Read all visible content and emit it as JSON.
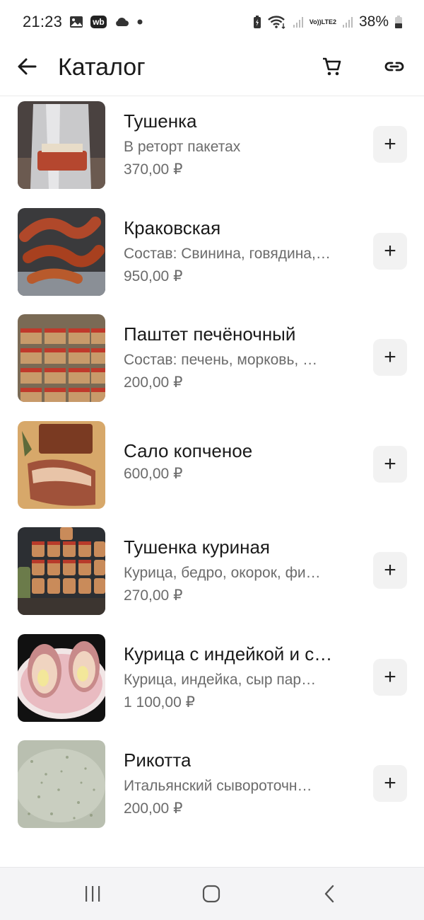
{
  "status_bar": {
    "time": "21:23",
    "wb_badge": "wb",
    "volte_line1": "Vo))",
    "volte_line2": "LTE2",
    "battery": "38%"
  },
  "app_bar": {
    "title": "Каталог",
    "back_icon": "arrow-left-icon",
    "cart_icon": "cart-icon",
    "link_icon": "link-icon"
  },
  "products": [
    {
      "title": "Тушенка",
      "desc": "В реторт пакетах",
      "price": "370,00 ₽",
      "add": "+"
    },
    {
      "title": "Краковская",
      "desc": "Состав: Свинина, говядина,…",
      "price": "950,00 ₽",
      "add": "+"
    },
    {
      "title": "Паштет печёночный",
      "desc": "Состав: печень, морковь, …",
      "price": "200,00 ₽",
      "add": "+"
    },
    {
      "title": "Сало копченое",
      "desc": "",
      "price": "600,00 ₽",
      "add": "+"
    },
    {
      "title": "Тушенка куриная",
      "desc": "Курица, бедро, окорок, фи…",
      "price": "270,00 ₽",
      "add": "+"
    },
    {
      "title": "Курица с индейкой и с…",
      "desc": "Курица, индейка, сыр пар…",
      "price": "1 100,00 ₽",
      "add": "+"
    },
    {
      "title": "Рикотта",
      "desc": "Итальянский сывороточн…",
      "price": "200,00 ₽",
      "add": "+"
    }
  ],
  "nav_bar": {
    "recents_icon": "recents-icon",
    "home_icon": "home-icon",
    "back_icon": "back-chevron-icon"
  },
  "colors": {
    "accent_text": "#1a1a1a",
    "secondary_text": "#6b6b6b",
    "add_button_bg": "#f2f2f2"
  }
}
